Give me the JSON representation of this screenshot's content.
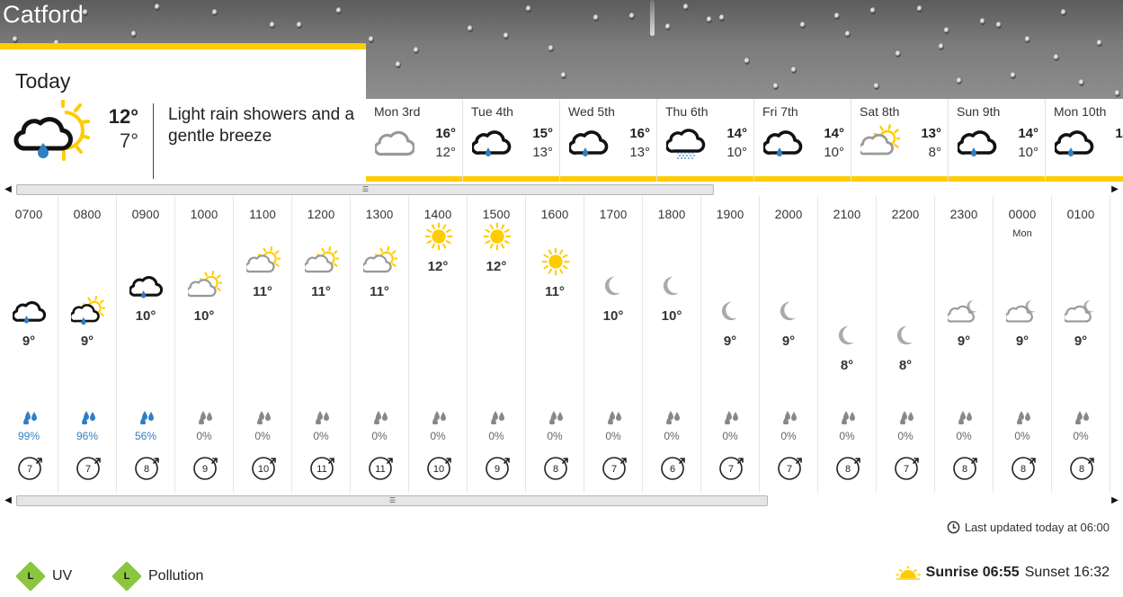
{
  "location": "Catford",
  "today": {
    "title": "Today",
    "icon": "light-rain-shower-day-icon",
    "high": "12°",
    "low": "7°",
    "description": "Light rain showers and a gentle breeze"
  },
  "days": [
    {
      "name": "Mon 3rd",
      "icon": "cloud",
      "high": "16°",
      "low": "12°"
    },
    {
      "name": "Tue 4th",
      "icon": "rain",
      "high": "15°",
      "low": "13°"
    },
    {
      "name": "Wed 5th",
      "icon": "rain",
      "high": "16°",
      "low": "13°"
    },
    {
      "name": "Thu 6th",
      "icon": "drizzle",
      "high": "14°",
      "low": "10°"
    },
    {
      "name": "Fri 7th",
      "icon": "rain",
      "high": "14°",
      "low": "10°"
    },
    {
      "name": "Sat 8th",
      "icon": "sun-cloud",
      "high": "13°",
      "low": "8°"
    },
    {
      "name": "Sun 9th",
      "icon": "rain",
      "high": "14°",
      "low": "10°"
    },
    {
      "name": "Mon 10th",
      "icon": "rain",
      "high": "14°",
      "low": ""
    }
  ],
  "hours": [
    {
      "hh": "07",
      "mm": "00",
      "day": "",
      "icon": "rain",
      "temp": "9°",
      "rain_pct": "99%",
      "wet": true,
      "wind": "7"
    },
    {
      "hh": "08",
      "mm": "00",
      "day": "",
      "icon": "rain-sun",
      "temp": "9°",
      "rain_pct": "96%",
      "wet": true,
      "wind": "7"
    },
    {
      "hh": "09",
      "mm": "00",
      "day": "",
      "icon": "rain",
      "temp": "10°",
      "rain_pct": "56%",
      "wet": true,
      "wind": "8"
    },
    {
      "hh": "10",
      "mm": "00",
      "day": "",
      "icon": "sun-cloud",
      "temp": "10°",
      "rain_pct": "0%",
      "wet": false,
      "wind": "9"
    },
    {
      "hh": "11",
      "mm": "00",
      "day": "",
      "icon": "sun-cloud",
      "temp": "11°",
      "rain_pct": "0%",
      "wet": false,
      "wind": "10"
    },
    {
      "hh": "12",
      "mm": "00",
      "day": "",
      "icon": "sun-cloud",
      "temp": "11°",
      "rain_pct": "0%",
      "wet": false,
      "wind": "11"
    },
    {
      "hh": "13",
      "mm": "00",
      "day": "",
      "icon": "sun-cloud",
      "temp": "11°",
      "rain_pct": "0%",
      "wet": false,
      "wind": "11"
    },
    {
      "hh": "14",
      "mm": "00",
      "day": "",
      "icon": "sun",
      "temp": "12°",
      "rain_pct": "0%",
      "wet": false,
      "wind": "10"
    },
    {
      "hh": "15",
      "mm": "00",
      "day": "",
      "icon": "sun",
      "temp": "12°",
      "rain_pct": "0%",
      "wet": false,
      "wind": "9"
    },
    {
      "hh": "16",
      "mm": "00",
      "day": "",
      "icon": "sun",
      "temp": "11°",
      "rain_pct": "0%",
      "wet": false,
      "wind": "8"
    },
    {
      "hh": "17",
      "mm": "00",
      "day": "",
      "icon": "moon",
      "temp": "10°",
      "rain_pct": "0%",
      "wet": false,
      "wind": "7"
    },
    {
      "hh": "18",
      "mm": "00",
      "day": "",
      "icon": "moon",
      "temp": "10°",
      "rain_pct": "0%",
      "wet": false,
      "wind": "6"
    },
    {
      "hh": "19",
      "mm": "00",
      "day": "",
      "icon": "moon",
      "temp": "9°",
      "rain_pct": "0%",
      "wet": false,
      "wind": "7"
    },
    {
      "hh": "20",
      "mm": "00",
      "day": "",
      "icon": "moon",
      "temp": "9°",
      "rain_pct": "0%",
      "wet": false,
      "wind": "7"
    },
    {
      "hh": "21",
      "mm": "00",
      "day": "",
      "icon": "moon",
      "temp": "8°",
      "rain_pct": "0%",
      "wet": false,
      "wind": "8"
    },
    {
      "hh": "22",
      "mm": "00",
      "day": "",
      "icon": "moon",
      "temp": "8°",
      "rain_pct": "0%",
      "wet": false,
      "wind": "7"
    },
    {
      "hh": "23",
      "mm": "00",
      "day": "",
      "icon": "moon-cloud",
      "temp": "9°",
      "rain_pct": "0%",
      "wet": false,
      "wind": "8"
    },
    {
      "hh": "00",
      "mm": "00",
      "day": "Mon",
      "icon": "moon-cloud",
      "temp": "9°",
      "rain_pct": "0%",
      "wet": false,
      "wind": "8"
    },
    {
      "hh": "01",
      "mm": "00",
      "day": "",
      "icon": "moon-cloud",
      "temp": "9°",
      "rain_pct": "0%",
      "wet": false,
      "wind": "8"
    }
  ],
  "updated": "Last updated today at 06:00",
  "uv": {
    "level": "L",
    "label": "UV"
  },
  "pollution": {
    "level": "L",
    "label": "Pollution"
  },
  "sunrise": "Sunrise 06:55",
  "sunset": "Sunset 16:32",
  "colors": {
    "accent": "#ffcc00",
    "rain": "#2f7fc4",
    "level_low": "#8cc63f"
  }
}
